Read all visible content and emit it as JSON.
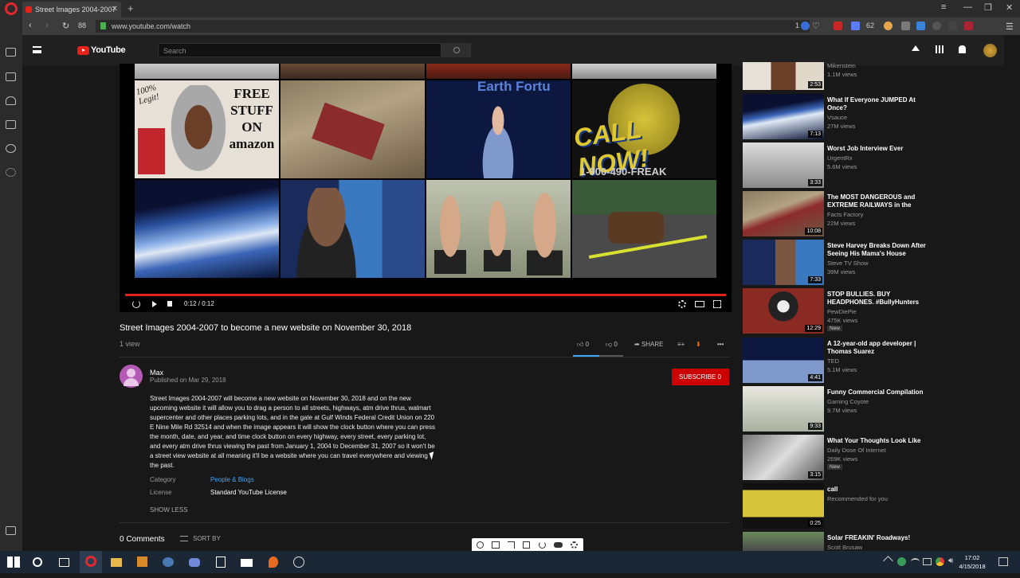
{
  "browser": {
    "tab_title": "Street Images 2004-2007",
    "url": "www.youtube.com/watch",
    "tab_count": "88",
    "ext_badge": "62",
    "ext_badge2": "1"
  },
  "youtube": {
    "logo_text": "YouTube",
    "search_placeholder": "Search"
  },
  "video": {
    "time": "0:12 / 0:12",
    "title": "Street Images 2004-2007 to become a new website on November 30, 2018",
    "views": "1 view",
    "likes": "0",
    "dislikes": "0",
    "share": "SHARE",
    "thumb_texts": {
      "legit": "100% Legit!",
      "free": "FREE STUFF ON amazon",
      "earth": "Earth Fortu",
      "callnow": "CALL NOW!",
      "phone": "1-900-490-FREAK"
    }
  },
  "channel": {
    "name": "Max",
    "published": "Published on Mar 29, 2018",
    "subscribe": "SUBSCRIBE 0"
  },
  "description": "Street Images 2004-2007 will become a new website on November 30, 2018 and on the new upcoming website it will allow you to drag a person to all streets, highways, atm drive thrus, walmart supercenter and other places parking lots, and in the gate at Gulf Winds Federal Credit Union on 220 E Nine Mile Rd 32514 and when the image appears it will show the clock button where you can press the month, date, and year, and time clock button on every highway, every street, every parking lot, and every atm drive thrus viewing the past from January 1, 2004 to December 31, 2007 so it won't be a street view website at all meaning it'll be a website where you can travel everywhere and viewing the past.",
  "meta": {
    "category_label": "Category",
    "category_value": "People & Blogs",
    "license_label": "License",
    "license_value": "Standard YouTube License",
    "show_less": "SHOW LESS"
  },
  "comments": {
    "count": "0 Comments",
    "sort": "SORT BY"
  },
  "recommendations": [
    {
      "title": "",
      "channel": "Mikenstein",
      "views": "1.1M views",
      "duration": "2:53",
      "badge": ""
    },
    {
      "title": "What If Everyone JUMPED At Once?",
      "channel": "Vsauce",
      "views": "27M views",
      "duration": "7:13",
      "badge": ""
    },
    {
      "title": "Worst Job Interview Ever",
      "channel": "UrgentRx",
      "views": "5.6M views",
      "duration": "3:33",
      "badge": ""
    },
    {
      "title": "The MOST DANGEROUS and EXTREME RAILWAYS in the",
      "channel": "Facts Factory",
      "views": "22M views",
      "duration": "10:08",
      "badge": ""
    },
    {
      "title": "Steve Harvey Breaks Down After Seeing His Mama's House",
      "channel": "Steve TV Show",
      "views": "39M views",
      "duration": "7:33",
      "badge": ""
    },
    {
      "title": "STOP BULLIES. BUY HEADPHONES. #BullyHunters",
      "channel": "PewDiePie",
      "views": "475K views",
      "duration": "12:29",
      "badge": "New"
    },
    {
      "title": "A 12-year-old app developer | Thomas Suarez",
      "channel": "TED",
      "views": "5.1M views",
      "duration": "4:41",
      "badge": ""
    },
    {
      "title": "Funny Commercial Compilation",
      "channel": "Gaming Coyote",
      "views": "9.7M views",
      "duration": "9:33",
      "badge": ""
    },
    {
      "title": "What Your Thoughts Look Like",
      "channel": "Daily Dose Of Internet",
      "views": "269K views",
      "duration": "3:15",
      "badge": "New"
    },
    {
      "title": "call",
      "channel": "Recommended for you",
      "views": "",
      "duration": "0:25",
      "badge": ""
    },
    {
      "title": "Solar FREAKIN' Roadways!",
      "channel": "Scott Brusaw",
      "views": "",
      "duration": "",
      "badge": ""
    }
  ],
  "taskbar": {
    "time": "17:02",
    "date": "4/15/2018"
  },
  "colors": {
    "accent": "#e62117",
    "link": "#3ea6ff",
    "background": "#181818"
  }
}
